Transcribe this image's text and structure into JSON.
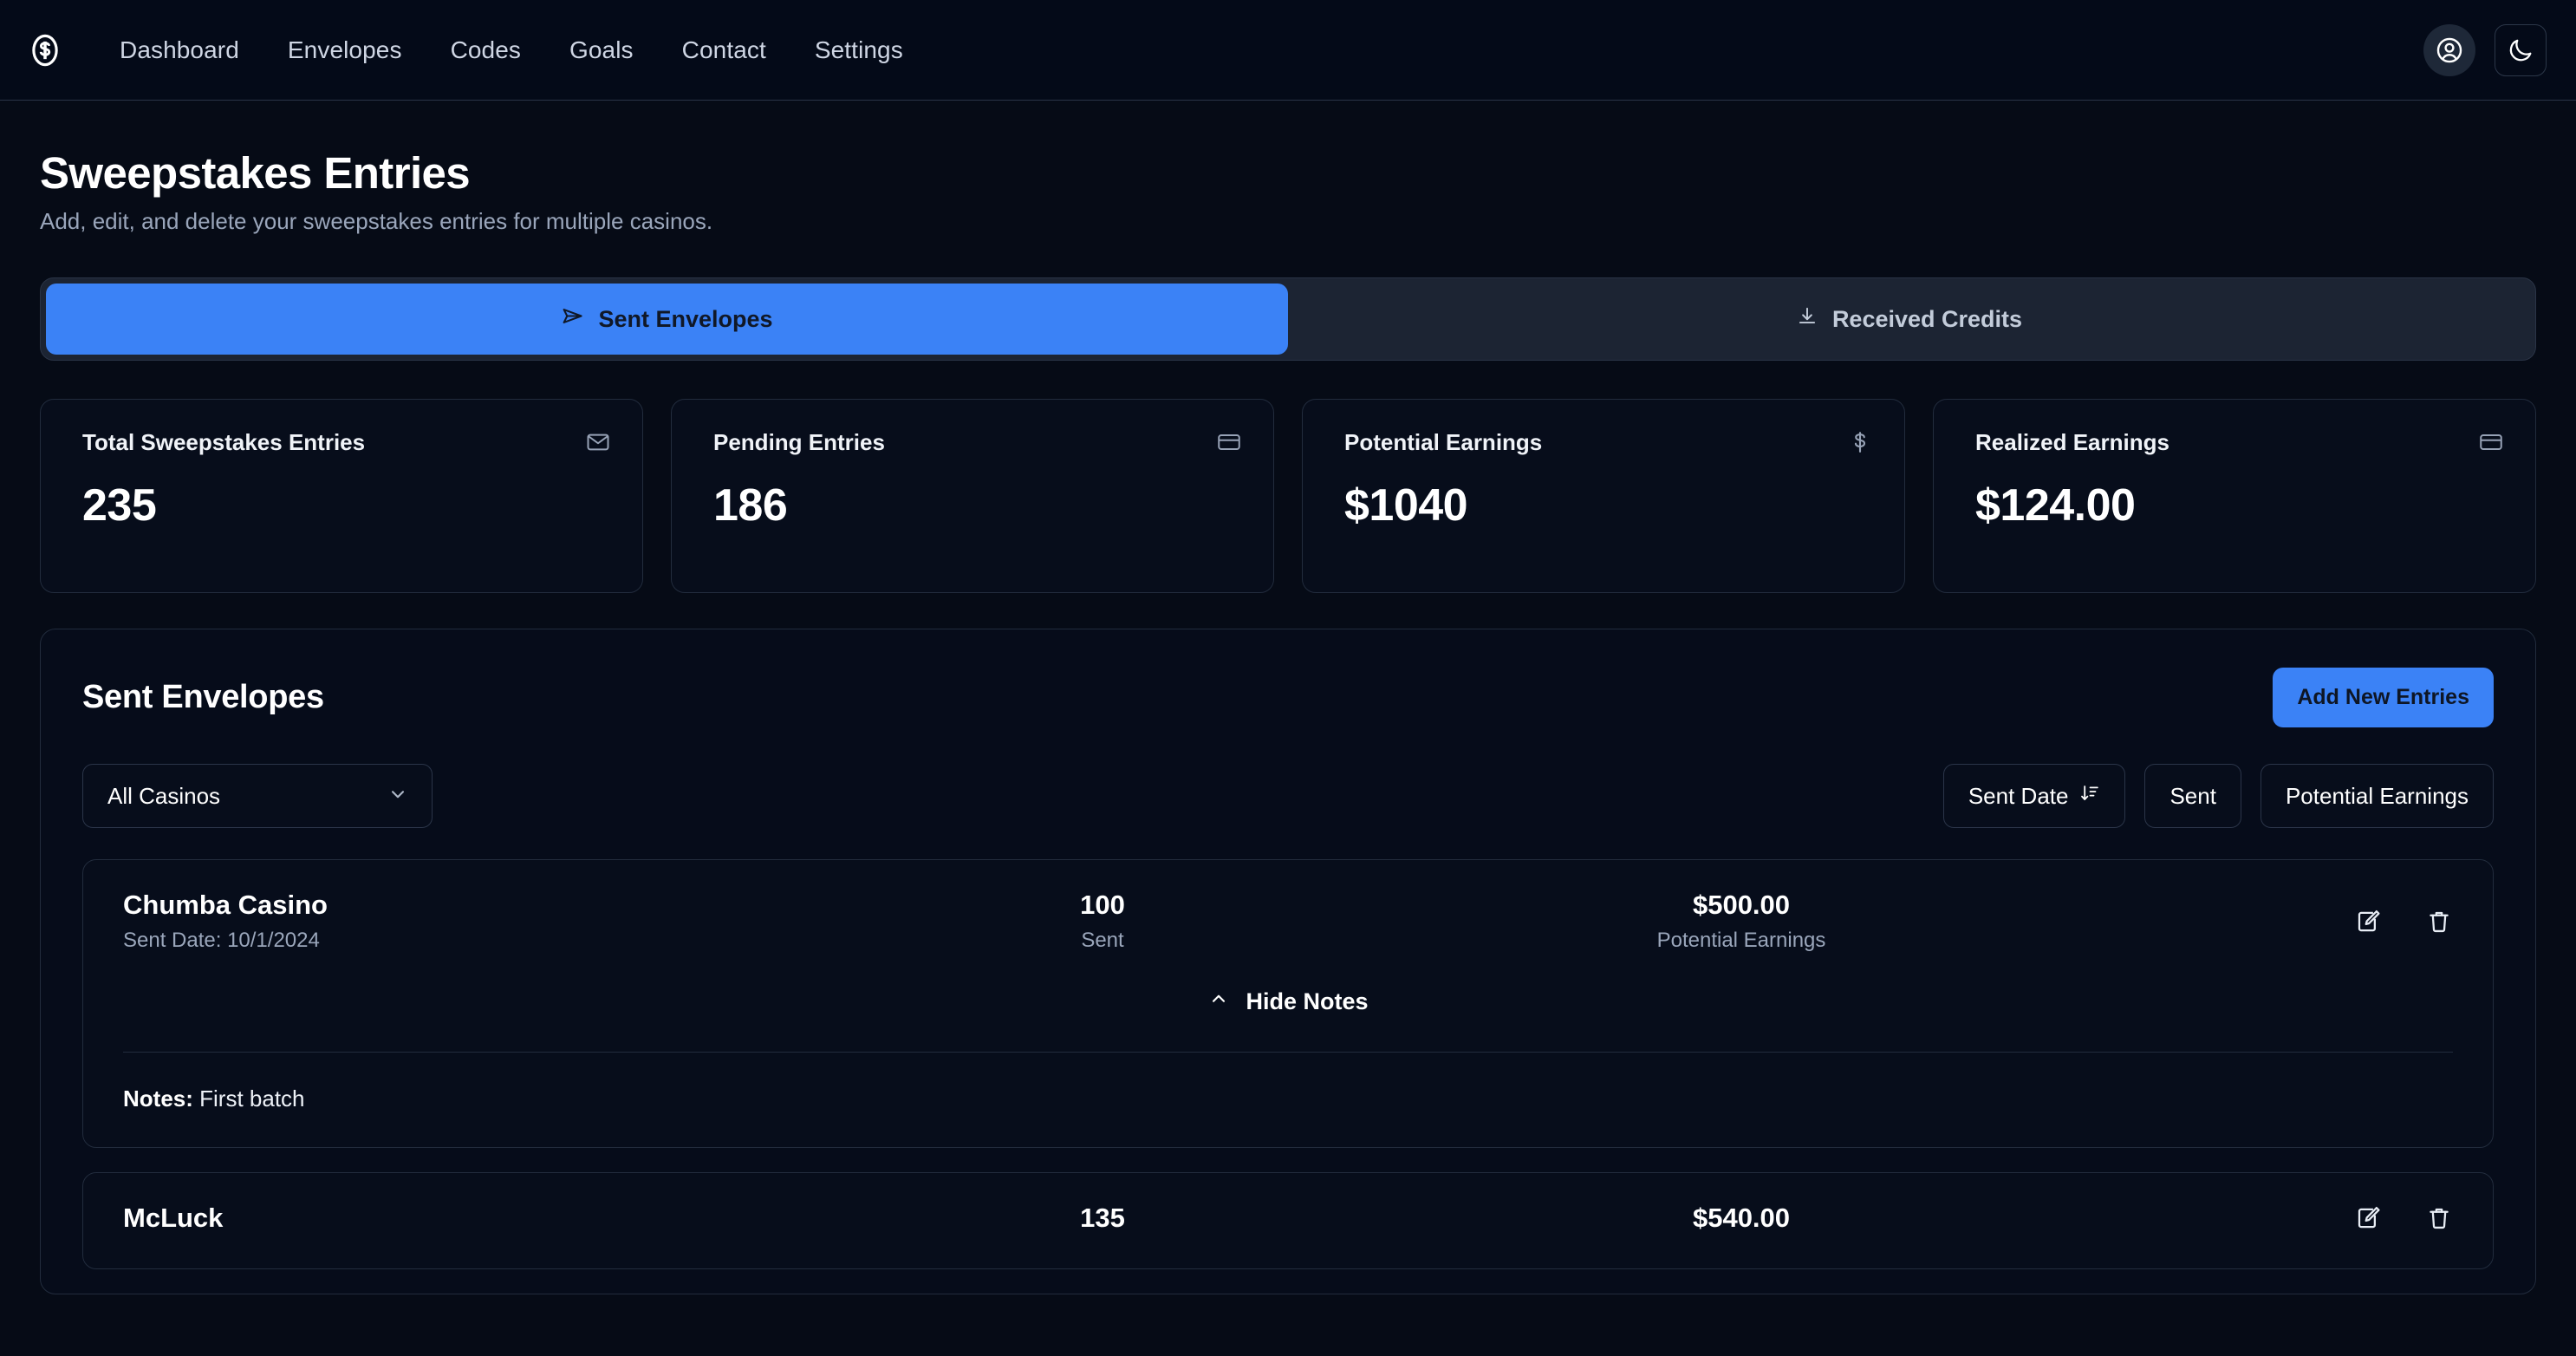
{
  "navbar": {
    "logo_icon": "dollar-circle-icon",
    "links": [
      {
        "label": "Dashboard"
      },
      {
        "label": "Envelopes"
      },
      {
        "label": "Codes"
      },
      {
        "label": "Goals"
      },
      {
        "label": "Contact"
      },
      {
        "label": "Settings"
      }
    ],
    "avatar_icon": "user-circle-icon",
    "theme_icon": "moon-icon"
  },
  "header": {
    "title": "Sweepstakes Entries",
    "subtitle": "Add, edit, and delete your sweepstakes entries for multiple casinos."
  },
  "tabs": [
    {
      "label": "Sent Envelopes",
      "icon": "send-icon",
      "active": true
    },
    {
      "label": "Received Credits",
      "icon": "download-icon",
      "active": false
    }
  ],
  "stats": [
    {
      "label": "Total Sweepstakes Entries",
      "value": "235",
      "icon": "envelope-icon"
    },
    {
      "label": "Pending Entries",
      "value": "186",
      "icon": "credit-card-icon"
    },
    {
      "label": "Potential Earnings",
      "value": "$1040",
      "icon": "dollar-icon"
    },
    {
      "label": "Realized Earnings",
      "value": "$124.00",
      "icon": "credit-card-icon"
    }
  ],
  "panel": {
    "title": "Sent Envelopes",
    "add_button": "Add New Entries",
    "casino_filter": {
      "selected": "All Casinos",
      "chevron_icon": "chevron-down-icon"
    },
    "sorts": [
      {
        "label": "Sent Date",
        "icon": "sort-descending-icon",
        "active": true
      },
      {
        "label": "Sent",
        "icon": "",
        "active": false
      },
      {
        "label": "Potential Earnings",
        "icon": "",
        "active": false
      }
    ]
  },
  "entries": [
    {
      "casino": "Chumba Casino",
      "date_label": "Sent Date: 10/1/2024",
      "sent_value": "100",
      "sent_label": "Sent",
      "earnings_value": "$500.00",
      "earnings_label": "Potential Earnings",
      "edit_icon": "edit-icon",
      "delete_icon": "trash-icon",
      "notes_toggle": "Hide Notes",
      "notes_toggle_icon": "chevron-up-icon",
      "notes_label": "Notes:",
      "notes_body": "First batch"
    },
    {
      "casino": "McLuck",
      "date_label": "",
      "sent_value": "135",
      "sent_label": "",
      "earnings_value": "$540.00",
      "earnings_label": "",
      "edit_icon": "edit-icon",
      "delete_icon": "trash-icon",
      "notes_toggle": "",
      "notes_toggle_icon": "",
      "notes_label": "",
      "notes_body": ""
    }
  ],
  "colors": {
    "accent_blue": "#3B82F6",
    "page_background": "#060b16",
    "navbar_background": "#040a18",
    "card_background": "#070d1b",
    "border": "#222c3d",
    "text_primary": "#FFFFFF",
    "text_muted": "#9AA6BB"
  }
}
